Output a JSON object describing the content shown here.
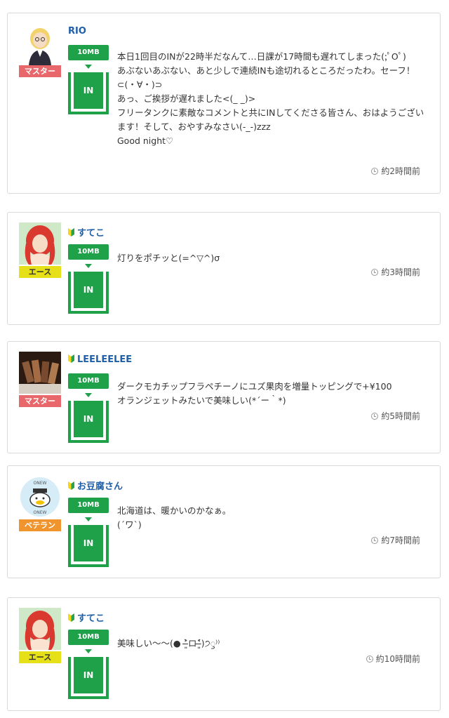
{
  "posts": [
    {
      "name": "RIO",
      "rank": "マスター",
      "data_amount": "10MB",
      "action": "IN",
      "message": "本日1回目のINが22時半だなんて…日課が17時間も遅れてしまった(;ﾟOﾟ)\nあぶないあぶない、あと少しで連続INも途切れるところだったわ。セーフ！⊂(・∀・)⊃\nあっ、ご挨拶が遅れました<(_ _)>\nフリータンクに素敵なコメントと共にINしてくださる皆さん、おはようございます！そして、おやすみなさい(-_-)zzz\nGood night♡",
      "time": "約2時間前",
      "beginner": false
    },
    {
      "name": "すてこ",
      "rank": "エース",
      "data_amount": "10MB",
      "action": "IN",
      "message": "灯りをポチッと(=^▽^)σ",
      "time": "約3時間前",
      "beginner": true
    },
    {
      "name": "LEELEELEE",
      "rank": "マスター",
      "data_amount": "10MB",
      "action": "IN",
      "message": "ダークモカチップフラペチーノにユズ果肉を増量トッピングで+¥100\nオランジェットみたいで美味しい(*´ー｀*)",
      "time": "約5時間前",
      "beginner": true
    },
    {
      "name": "お豆腐さん",
      "rank": "ベテラン",
      "data_amount": "10MB",
      "action": "IN",
      "message": "北海道は、暖かいのかなぁ。\n(´ワ`)",
      "time": "約7時間前",
      "beginner": true
    },
    {
      "name": "すてこ",
      "rank": "エース",
      "data_amount": "10MB",
      "action": "IN",
      "message": "美味しい〜〜(● ˃̶͈̀ロ˂̶͈́)੭ꠥ⁾⁾",
      "time": "約10時間前",
      "beginner": true
    }
  ]
}
